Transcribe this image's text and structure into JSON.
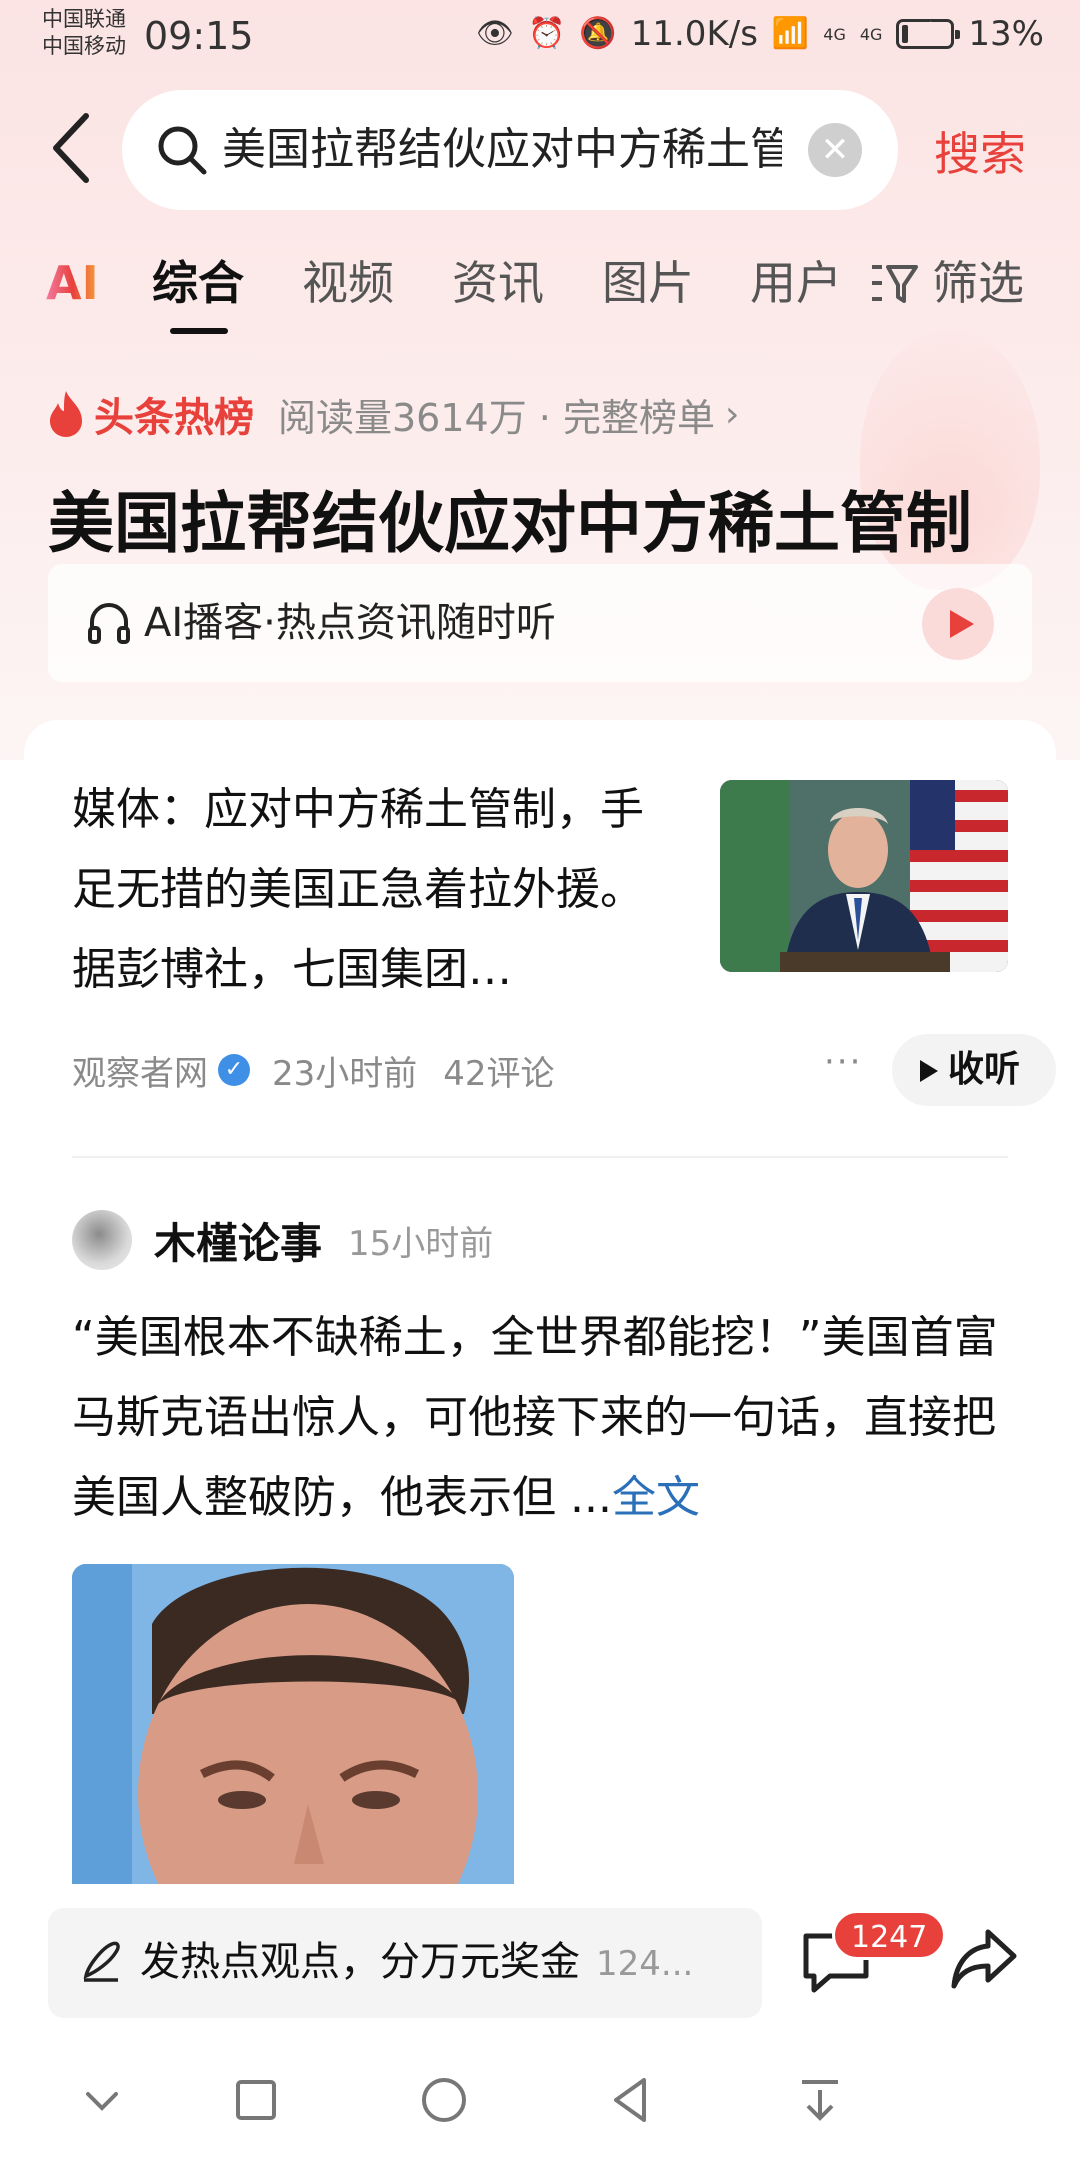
{
  "status_bar": {
    "carrier_1": "中国联通",
    "carrier_2": "中国移动",
    "time": "09:15",
    "net_speed": "11.0K/s",
    "signal_1": "4G",
    "signal_2": "4G",
    "battery": "13%",
    "battery_level": 0.13
  },
  "search": {
    "query": "美国拉帮结伙应对中方稀土管",
    "button_label": "搜索"
  },
  "tabs": [
    {
      "label": "AI"
    },
    {
      "label": "综合",
      "active": true
    },
    {
      "label": "视频"
    },
    {
      "label": "资讯"
    },
    {
      "label": "图片"
    },
    {
      "label": "用户"
    }
  ],
  "filter_label": "筛选",
  "hot_list": {
    "title": "头条热榜",
    "reads": "阅读量3614万 · 完整榜单",
    "headline": "美国拉帮结伙应对中方稀土管制"
  },
  "podcast": {
    "label": "AI播客·热点资讯随时听"
  },
  "article": {
    "text": "媒体：应对中方稀土管制，手足无措的美国正急着拉外援。据彭博社，七国集团…",
    "source": "观察者网",
    "time": "23小时前",
    "comments": "42评论",
    "more": "···",
    "listen_label": "收听"
  },
  "post": {
    "author": "木槿论事",
    "time": "15小时前",
    "text": "“美国根本不缺稀土，全世界都能挖！”美国首富马斯克语出惊人，可他接下来的一句话，直接把美国人整破防，他表示但 ...",
    "full_text_link": "全文"
  },
  "bottom_bar": {
    "comment_prompt": "发热点观点，分万元奖金",
    "comment_count_inline": "124...",
    "comment_badge": "1247"
  },
  "colors": {
    "accent": "#e8413c",
    "link": "#2a6fb8",
    "background_top": "#fbe4e3"
  },
  "icons": [
    "back-icon",
    "search-icon",
    "clear-icon",
    "filter-icon",
    "fire-icon",
    "headphone-icon",
    "play-icon",
    "verified-icon",
    "more-icon",
    "pen-icon",
    "comment-icon",
    "share-icon"
  ]
}
